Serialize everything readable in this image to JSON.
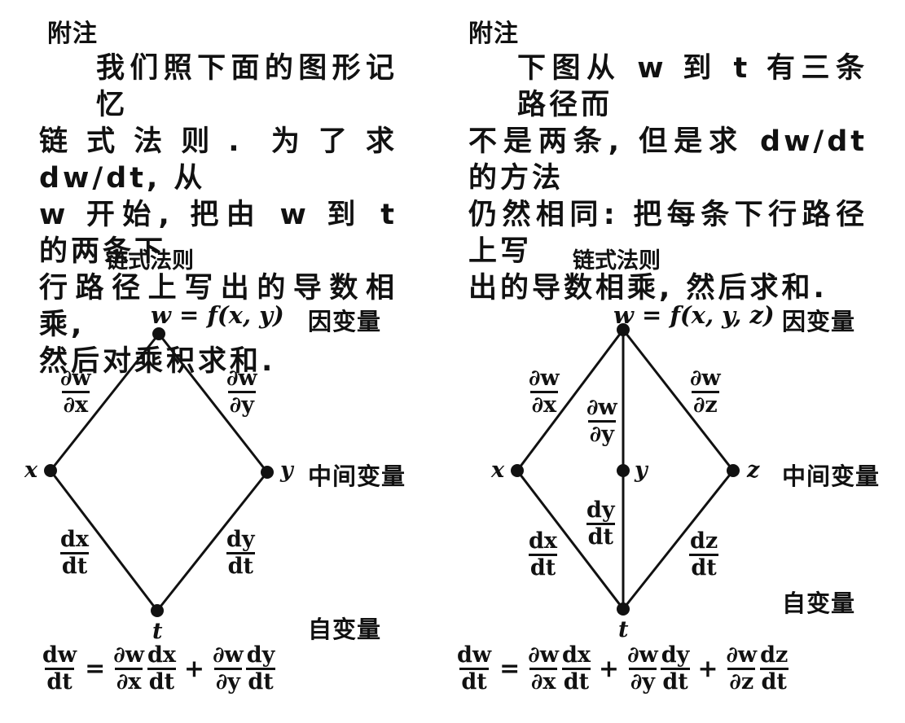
{
  "left": {
    "heading": "附注",
    "paragraph_lines": [
      "我们照下面的图形记忆",
      "链式法则. 为了求 dw/dt, 从",
      "w 开始, 把由 w 到 t 的两条下",
      "行路径上写出的导数相乘,",
      "然后对乘积求和."
    ],
    "diagram_title": "链式法则",
    "top_label": "w = f(x, y)",
    "levels": {
      "dependent": "因变量",
      "intermediate": "中间变量",
      "independent": "自变量"
    },
    "vars": {
      "x": "x",
      "y": "y",
      "t": "t"
    },
    "edges": {
      "dw_dx": {
        "num": "∂w",
        "den": "∂x"
      },
      "dw_dy": {
        "num": "∂w",
        "den": "∂y"
      },
      "dx_dt": {
        "num": "dx",
        "den": "dt"
      },
      "dy_dt": {
        "num": "dy",
        "den": "dt"
      }
    },
    "equation": {
      "lhs": {
        "num": "dw",
        "den": "dt"
      },
      "eq": "=",
      "plus": "+",
      "terms": [
        [
          {
            "num": "∂w",
            "den": "∂x"
          },
          {
            "num": "dx",
            "den": "dt"
          }
        ],
        [
          {
            "num": "∂w",
            "den": "∂y"
          },
          {
            "num": "dy",
            "den": "dt"
          }
        ]
      ]
    }
  },
  "right": {
    "heading": "附注",
    "paragraph_lines": [
      "下图从 w 到 t 有三条路径而",
      "不是两条, 但是求 dw/dt 的方法",
      "仍然相同: 把每条下行路径上写",
      "出的导数相乘, 然后求和."
    ],
    "diagram_title": "链式法则",
    "top_label": "w = f(x, y, z)",
    "levels": {
      "dependent": "因变量",
      "intermediate": "中间变量",
      "independent": "自变量"
    },
    "vars": {
      "x": "x",
      "y": "y",
      "z": "z",
      "t": "t"
    },
    "edges": {
      "dw_dx": {
        "num": "∂w",
        "den": "∂x"
      },
      "dw_dy": {
        "num": "∂w",
        "den": "∂y"
      },
      "dw_dz": {
        "num": "∂w",
        "den": "∂z"
      },
      "dx_dt": {
        "num": "dx",
        "den": "dt"
      },
      "dy_dt": {
        "num": "dy",
        "den": "dt"
      },
      "dz_dt": {
        "num": "dz",
        "den": "dt"
      }
    },
    "equation": {
      "lhs": {
        "num": "dw",
        "den": "dt"
      },
      "eq": "=",
      "plus": "+",
      "terms": [
        [
          {
            "num": "∂w",
            "den": "∂x"
          },
          {
            "num": "dx",
            "den": "dt"
          }
        ],
        [
          {
            "num": "∂w",
            "den": "∂y"
          },
          {
            "num": "dy",
            "den": "dt"
          }
        ],
        [
          {
            "num": "∂w",
            "den": "∂z"
          },
          {
            "num": "dz",
            "den": "dt"
          }
        ]
      ]
    }
  },
  "colors": {
    "ink": "#111111",
    "paper": "#ffffff"
  }
}
